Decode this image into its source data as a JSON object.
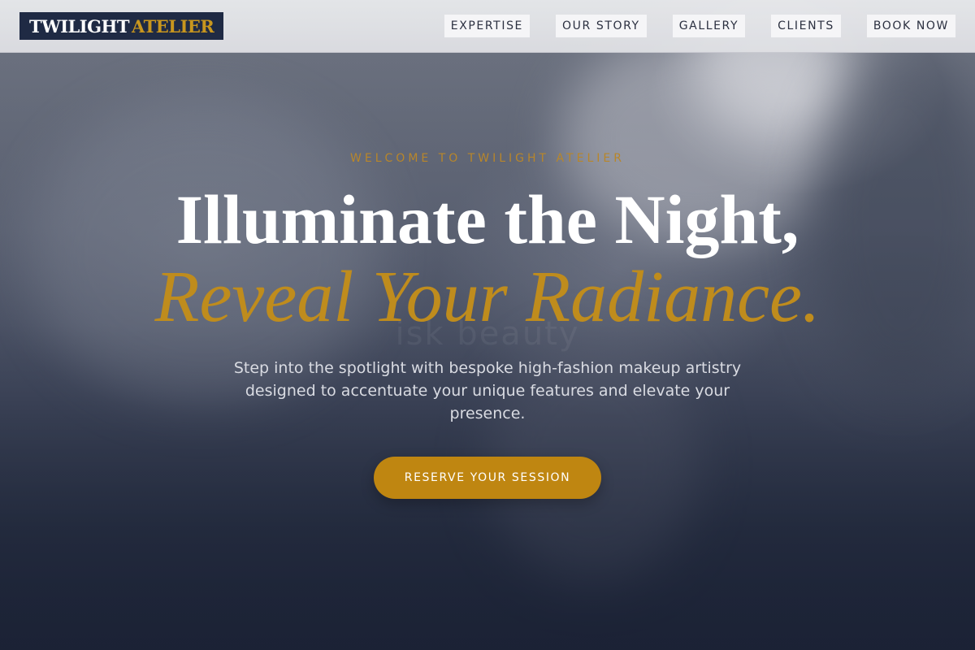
{
  "brand": {
    "part1": "TWILIGHT",
    "part2": "ATELIER"
  },
  "nav": {
    "items": [
      {
        "label": "EXPERTISE"
      },
      {
        "label": "OUR STORY"
      },
      {
        "label": "GALLERY"
      },
      {
        "label": "CLIENTS"
      },
      {
        "label": "BOOK NOW"
      }
    ]
  },
  "hero": {
    "kicker": "WELCOME TO TWILIGHT ATELIER",
    "headline_line1": "Illuminate the Night,",
    "headline_line2": "Reveal Your Radiance.",
    "watermark": "isk beauty",
    "subtext": "Step into the spotlight with bespoke high-fashion makeup artistry designed to accentuate your unique features and elevate your presence.",
    "cta_label": "RESERVE YOUR SESSION"
  },
  "colors": {
    "accent": "#bf8611",
    "navy": "#1f2a44",
    "header_bg": "#e4e5e8"
  }
}
